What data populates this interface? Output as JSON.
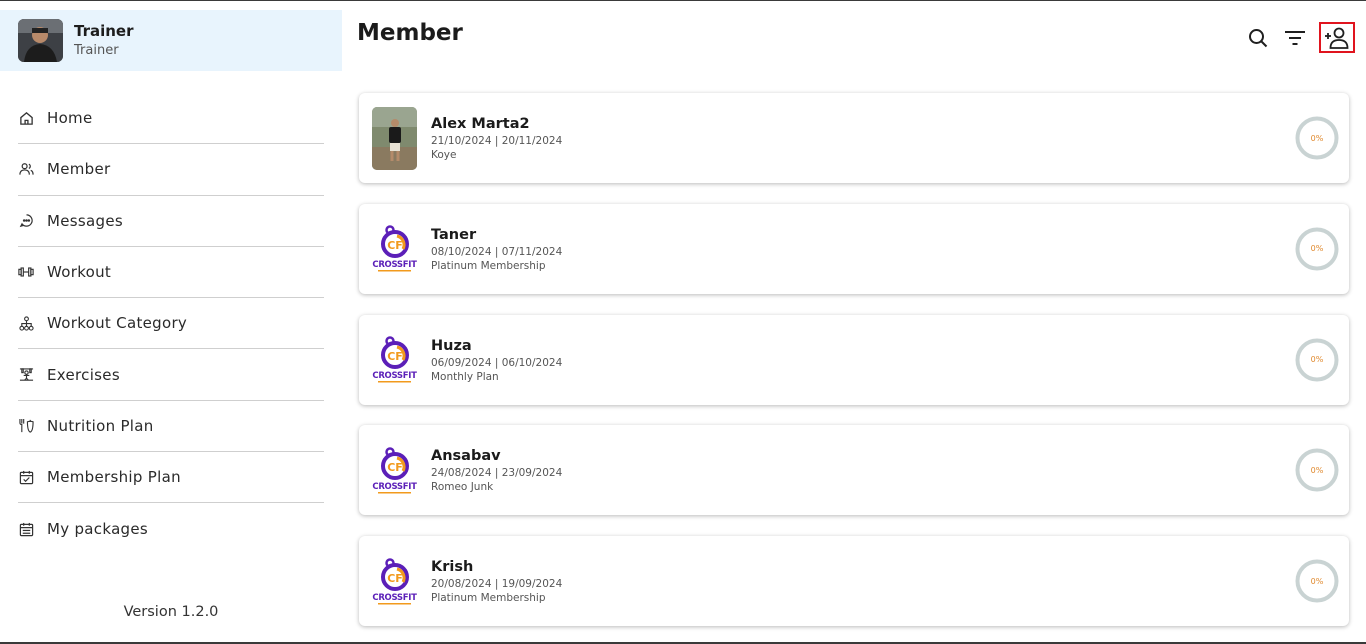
{
  "profile": {
    "name": "Trainer",
    "role": "Trainer"
  },
  "nav": [
    {
      "label": "Home",
      "icon": "home-icon"
    },
    {
      "label": "Member",
      "icon": "users-icon"
    },
    {
      "label": "Messages",
      "icon": "chat-icon"
    },
    {
      "label": "Workout",
      "icon": "dumbbell-icon"
    },
    {
      "label": "Workout Category",
      "icon": "hierarchy-icon"
    },
    {
      "label": "Exercises",
      "icon": "exercise-icon"
    },
    {
      "label": "Nutrition Plan",
      "icon": "nutrition-icon"
    },
    {
      "label": "Membership Plan",
      "icon": "calendar-check-icon"
    },
    {
      "label": "My packages",
      "icon": "calendar-list-icon"
    }
  ],
  "version": "Version 1.2.0",
  "page": {
    "title": "Member"
  },
  "header": {
    "icons": [
      "search-icon",
      "filter-icon",
      "add-user-icon"
    ]
  },
  "members": [
    {
      "name": "Alex Marta2",
      "dates": "21/10/2024 | 20/11/2024",
      "plan": "Koye",
      "progress": "0%",
      "thumb": "photo"
    },
    {
      "name": "Taner",
      "dates": "08/10/2024 | 07/11/2024",
      "plan": "Platinum Membership",
      "progress": "0%",
      "thumb": "crossfit-logo"
    },
    {
      "name": "Huza",
      "dates": "06/09/2024 | 06/10/2024",
      "plan": "Monthly Plan",
      "progress": "0%",
      "thumb": "crossfit-logo"
    },
    {
      "name": "Ansabav",
      "dates": "24/08/2024 | 23/09/2024",
      "plan": "Romeo Junk",
      "progress": "0%",
      "thumb": "crossfit-logo"
    },
    {
      "name": "Krish",
      "dates": "20/08/2024 | 19/09/2024",
      "plan": "Platinum Membership",
      "progress": "0%",
      "thumb": "crossfit-logo"
    }
  ],
  "logo_text": "CROSSFIT",
  "colors": {
    "profile_bg": "#e8f4fd",
    "accent_red": "#e0141e",
    "progress_ring": "#c9d3d3",
    "progress_text": "#e08a2f",
    "logo_purple": "#5b1fb8",
    "logo_orange": "#f29a1c"
  }
}
